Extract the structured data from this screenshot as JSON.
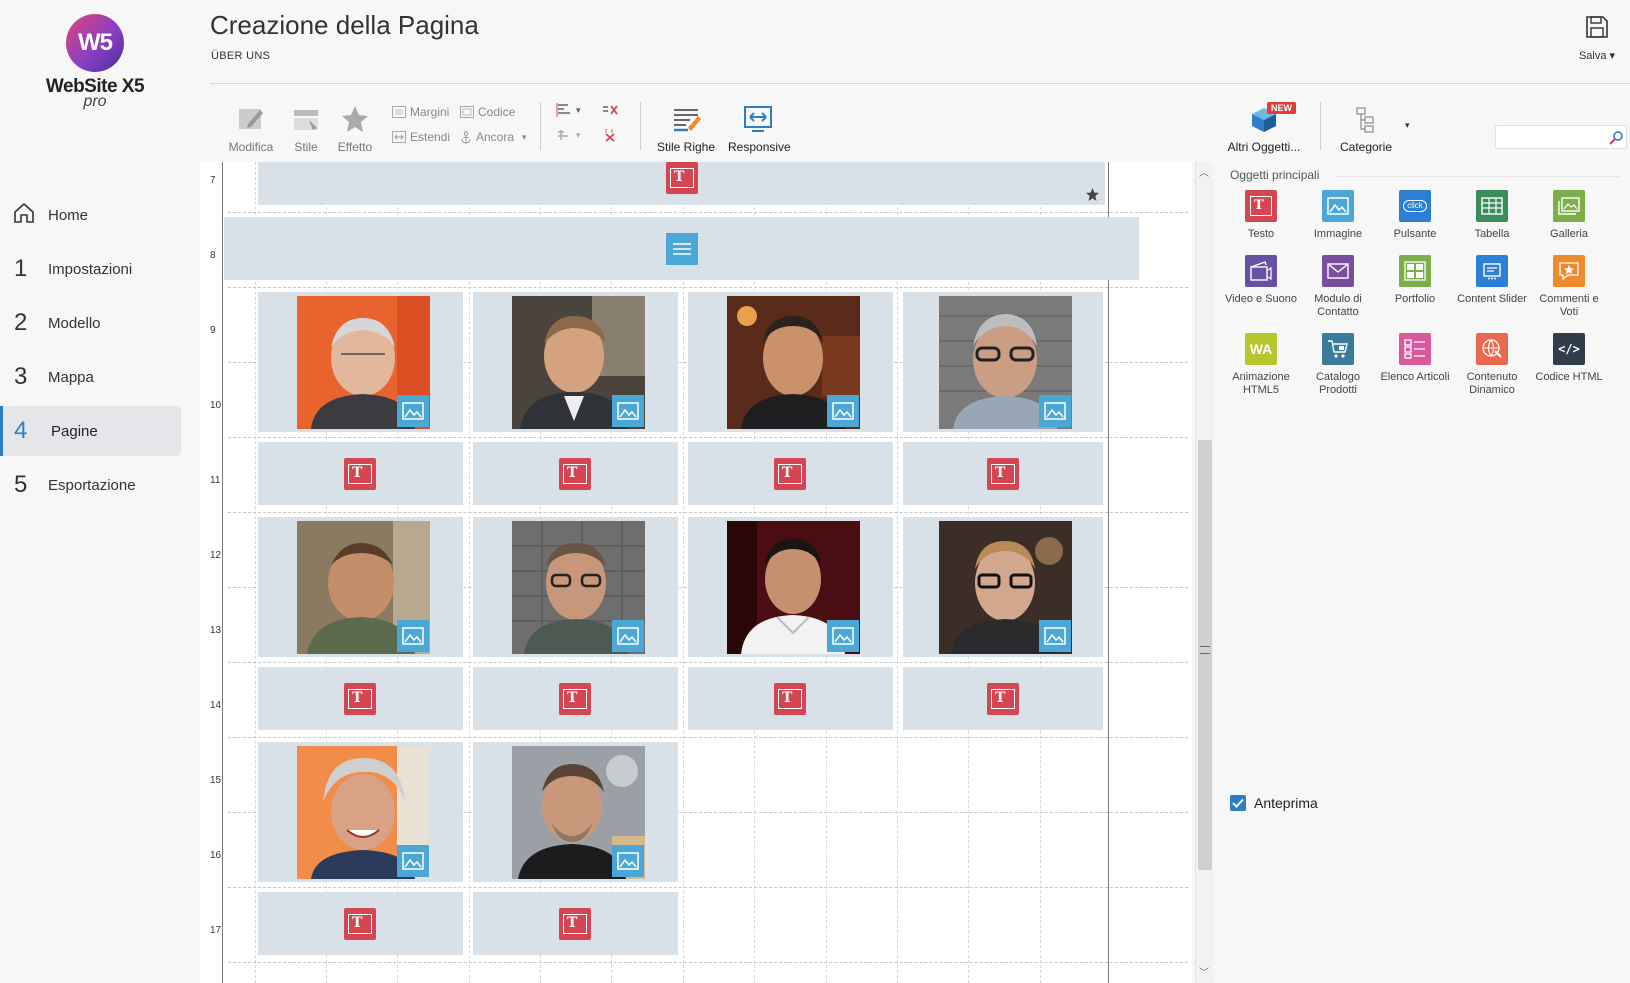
{
  "app": {
    "logo_initials": "W5",
    "logo_name": "WebSite X5",
    "logo_edition": "pro"
  },
  "nav": [
    {
      "num": "",
      "label": "Home",
      "active": false
    },
    {
      "num": "1",
      "label": "Impostazioni",
      "active": false
    },
    {
      "num": "2",
      "label": "Modello",
      "active": false
    },
    {
      "num": "3",
      "label": "Mappa",
      "active": false
    },
    {
      "num": "4",
      "label": "Pagine",
      "active": true
    },
    {
      "num": "5",
      "label": "Esportazione",
      "active": false
    }
  ],
  "header": {
    "title": "Creazione della Pagina",
    "subtitle": "ÜBER UNS",
    "save_label": "Salva"
  },
  "toolbar": {
    "modifica": "Modifica",
    "stile": "Stile",
    "effetto": "Effetto",
    "margini": "Margini",
    "estendi": "Estendi",
    "codice": "Codice",
    "ancora": "Ancora",
    "stile_righe": "Stile Righe",
    "responsive": "Responsive",
    "altri_oggetti": "Altri Oggetti...",
    "new_badge": "NEW",
    "categorie": "Categorie",
    "search_placeholder": ""
  },
  "canvas": {
    "row_numbers": [
      "7",
      "8",
      "9",
      "10",
      "11",
      "12",
      "13",
      "14",
      "15",
      "16",
      "17"
    ]
  },
  "panel": {
    "title": "Oggetti principali",
    "objects": [
      {
        "label": "Testo",
        "color": "#d64552",
        "icon": "text-icon"
      },
      {
        "label": "Immagine",
        "color": "#4ba8d6",
        "icon": "image-icon"
      },
      {
        "label": "Pulsante",
        "color": "#2b7fd4",
        "icon": "button-icon"
      },
      {
        "label": "Tabella",
        "color": "#3c8c5c",
        "icon": "table-icon"
      },
      {
        "label": "Galleria",
        "color": "#7dae4a",
        "icon": "gallery-icon"
      },
      {
        "label": "Video e Suono",
        "color": "#6552a3",
        "icon": "video-icon"
      },
      {
        "label": "Modulo di Contatto",
        "color": "#7a4da0",
        "icon": "mail-icon"
      },
      {
        "label": "Portfolio",
        "color": "#7dae4a",
        "icon": "portfolio-icon"
      },
      {
        "label": "Content Slider",
        "color": "#2b7fd4",
        "icon": "slider-icon"
      },
      {
        "label": "Commenti e Voti",
        "color": "#ee8a2a",
        "icon": "star-icon"
      },
      {
        "label": "Animazione HTML5",
        "color": "#b8c62d",
        "icon": "animation-icon"
      },
      {
        "label": "Catalogo Prodotti",
        "color": "#3a7b9a",
        "icon": "cart-icon"
      },
      {
        "label": "Elenco Articoli",
        "color": "#d85a9c",
        "icon": "list-icon"
      },
      {
        "label": "Contenuto Dinamico",
        "color": "#ea6a4f",
        "icon": "globe-icon"
      },
      {
        "label": "Codice HTML",
        "color": "#2f3e4a",
        "icon": "code-icon"
      }
    ],
    "preview_label": "Anteprima",
    "preview_checked": true
  }
}
